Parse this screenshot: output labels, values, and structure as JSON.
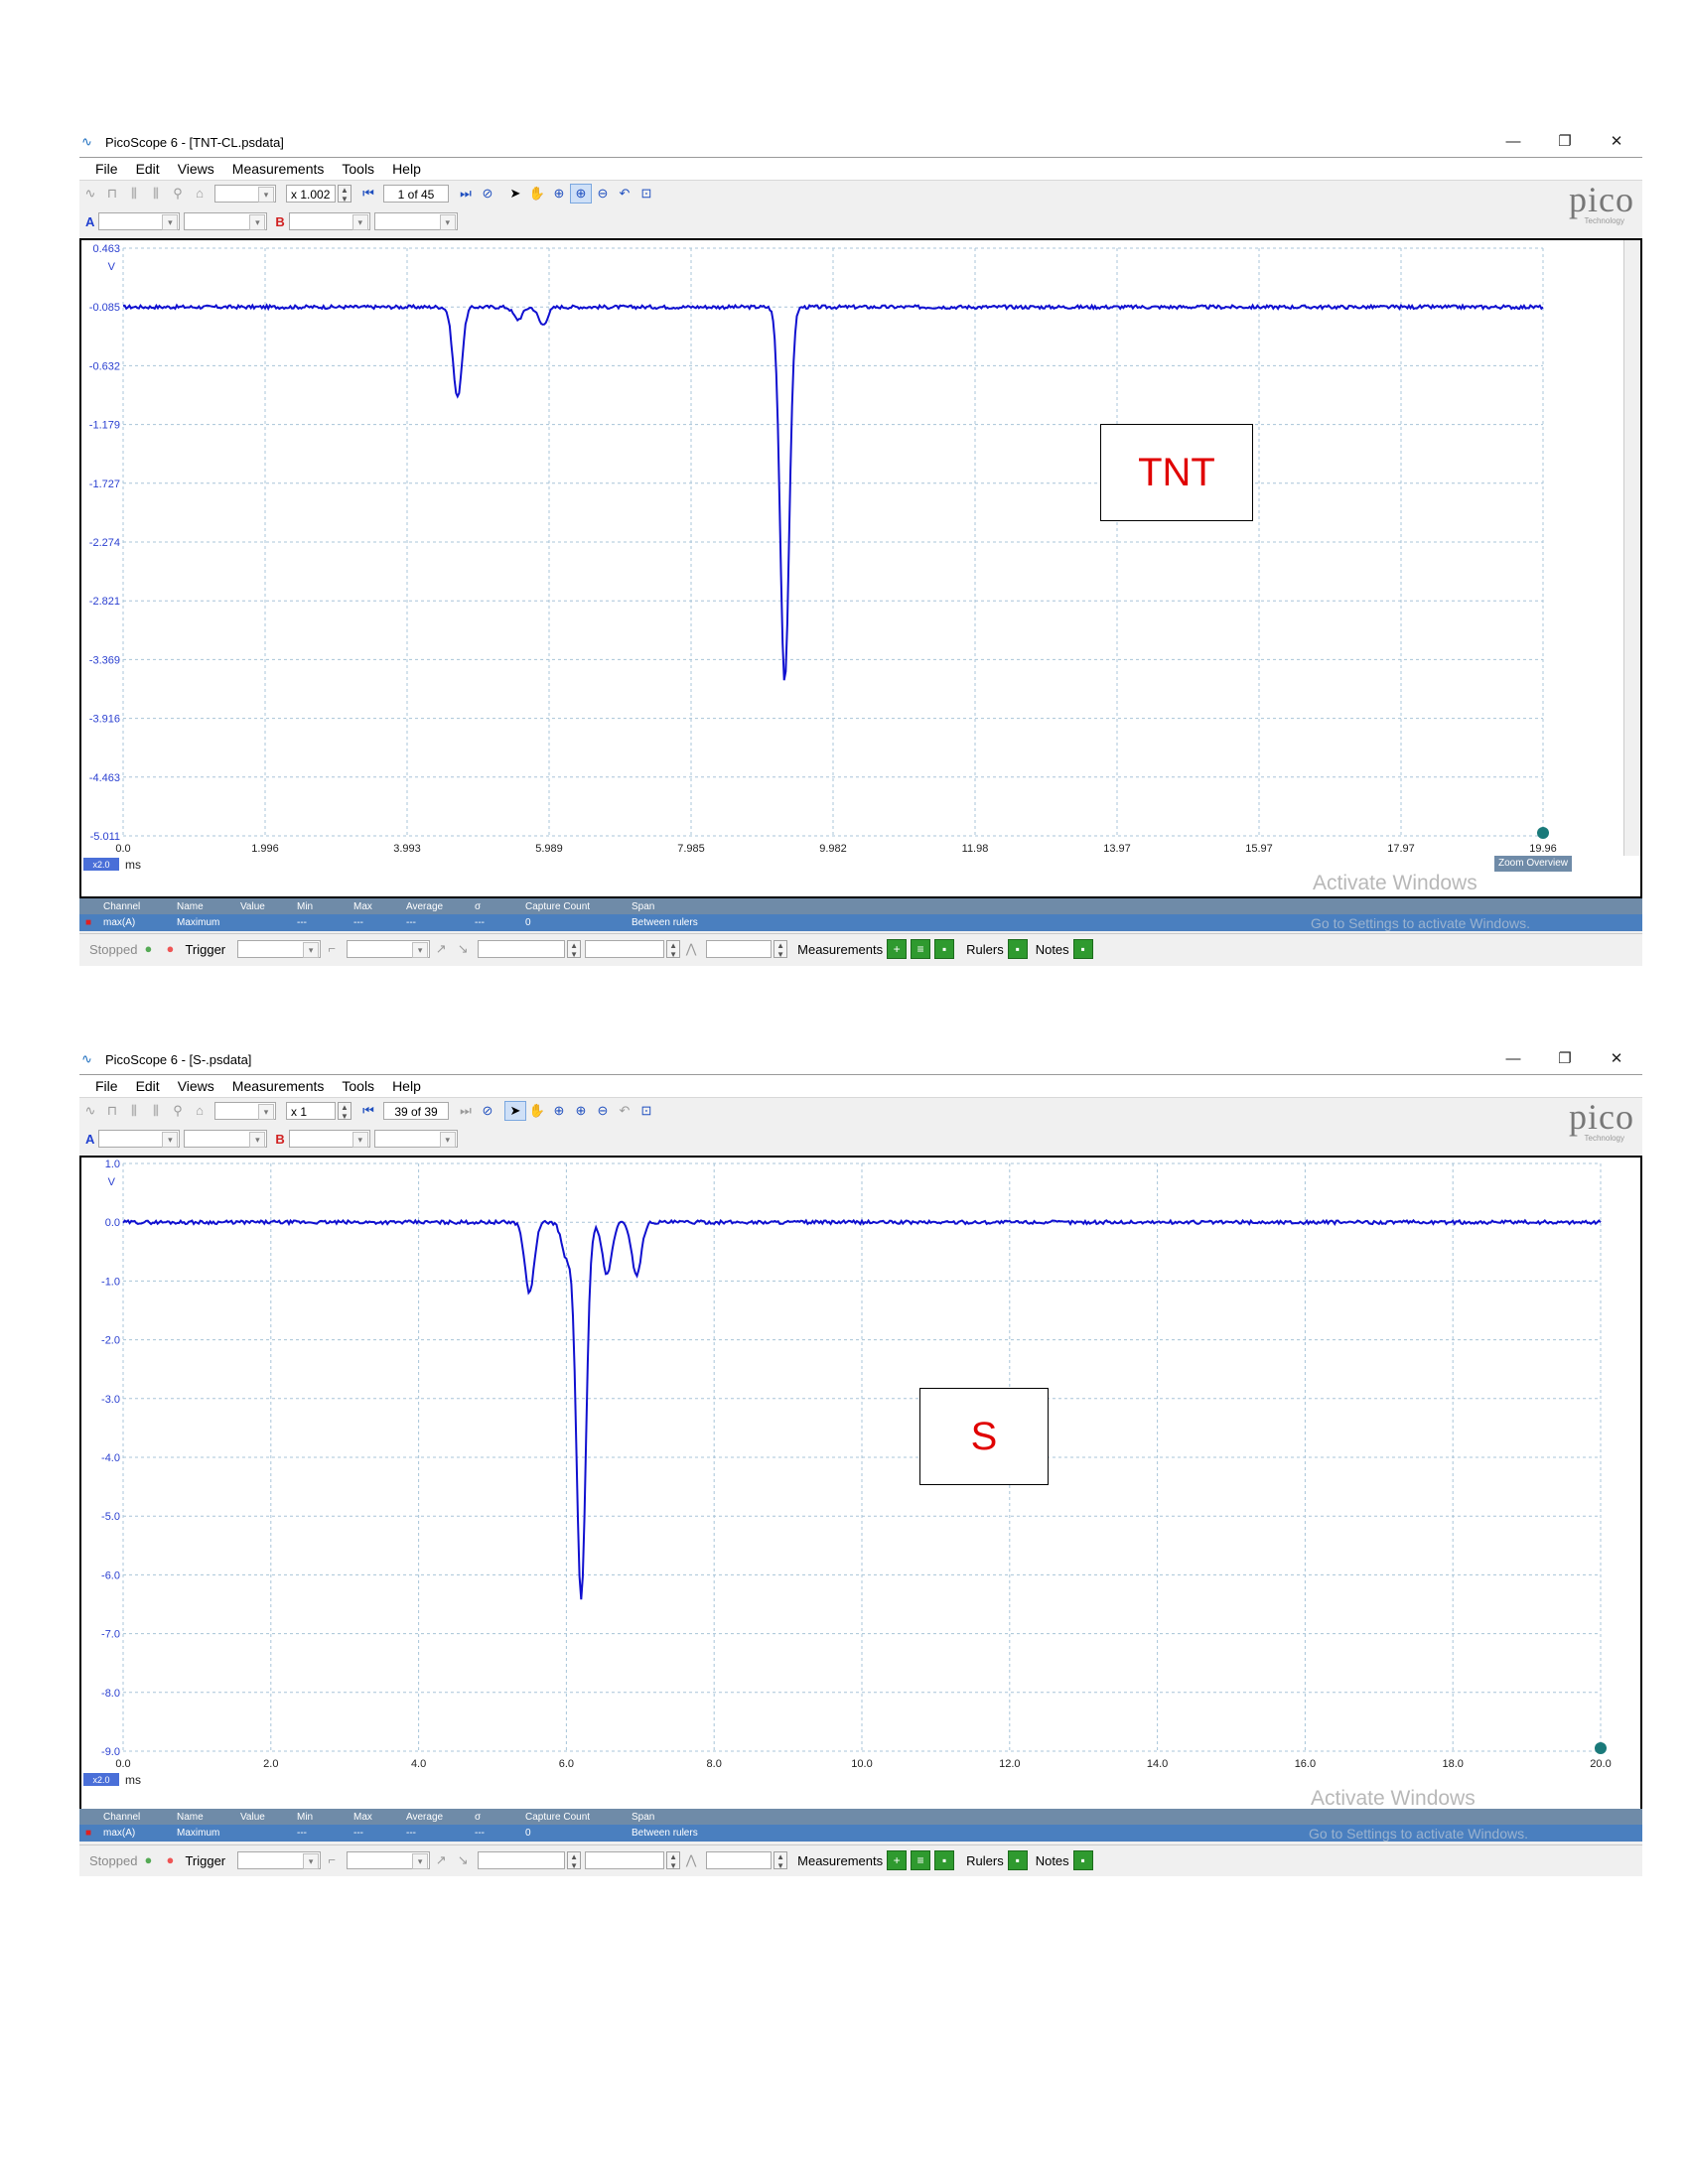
{
  "windows": [
    {
      "title": "PicoScope 6 - [TNT-CL.psdata]",
      "menu": [
        "File",
        "Edit",
        "Views",
        "Measurements",
        "Tools",
        "Help"
      ],
      "zoom_field": "x 1.002",
      "capture_counter": "1 of 45",
      "channel_a": "A",
      "channel_b": "B",
      "y_unit": "V",
      "x_unit": "ms",
      "zoom_badge": "x2.0",
      "y_ticks": [
        "0.463",
        "-0.085",
        "-0.632",
        "-1.179",
        "-1.727",
        "-2.274",
        "-2.821",
        "-3.369",
        "-3.916",
        "-4.463",
        "-5.011"
      ],
      "x_ticks": [
        "0.0",
        "1.996",
        "3.993",
        "5.989",
        "7.985",
        "9.982",
        "11.98",
        "13.97",
        "15.97",
        "17.97",
        "19.96"
      ],
      "annotation": "TNT",
      "zoom_overview": "Zoom Overview",
      "measurements": {
        "headers": [
          "Channel",
          "Name",
          "Value",
          "Min",
          "Max",
          "Average",
          "σ",
          "Capture Count",
          "Span"
        ],
        "row": [
          "max(A)",
          "Maximum",
          "",
          "---",
          "---",
          "---",
          "---",
          "0",
          "Between rulers"
        ]
      },
      "watermark": [
        "Activate Windows",
        "Go to Settings to activate Windows."
      ],
      "status": {
        "state": "Stopped",
        "trigger": "Trigger",
        "measurements": "Measurements",
        "rulers": "Rulers",
        "notes": "Notes"
      }
    },
    {
      "title": "PicoScope 6 - [S-.psdata]",
      "menu": [
        "File",
        "Edit",
        "Views",
        "Measurements",
        "Tools",
        "Help"
      ],
      "zoom_field": "x 1",
      "capture_counter": "39 of 39",
      "channel_a": "A",
      "channel_b": "B",
      "y_unit": "V",
      "x_unit": "ms",
      "zoom_badge": "x2.0",
      "y_ticks": [
        "1.0",
        "0.0",
        "-1.0",
        "-2.0",
        "-3.0",
        "-4.0",
        "-5.0",
        "-6.0",
        "-7.0",
        "-8.0",
        "-9.0"
      ],
      "x_ticks": [
        "0.0",
        "2.0",
        "4.0",
        "6.0",
        "8.0",
        "10.0",
        "12.0",
        "14.0",
        "16.0",
        "18.0",
        "20.0"
      ],
      "annotation": "S",
      "measurements": {
        "headers": [
          "Channel",
          "Name",
          "Value",
          "Min",
          "Max",
          "Average",
          "σ",
          "Capture Count",
          "Span"
        ],
        "row": [
          "max(A)",
          "Maximum",
          "",
          "---",
          "---",
          "---",
          "---",
          "0",
          "Between rulers"
        ]
      },
      "watermark": [
        "Activate Windows",
        "Go to Settings to activate Windows."
      ],
      "status": {
        "state": "Stopped",
        "trigger": "Trigger",
        "measurements": "Measurements",
        "rulers": "Rulers",
        "notes": "Notes"
      }
    }
  ],
  "logo": {
    "text": "pico",
    "sub": "Technology"
  },
  "colors": {
    "trace": "#1010d0",
    "grid": "#a8c4d8",
    "axis_text": "#2a3fd0",
    "annotation": "#e00000"
  },
  "chart_data": [
    {
      "type": "line",
      "xlabel": "ms",
      "ylabel": "V",
      "xlim": [
        0,
        19.96
      ],
      "ylim": [
        -5.011,
        0.463
      ],
      "baseline": -0.085,
      "peaks": [
        {
          "x": 4.7,
          "y": -0.93
        },
        {
          "x": 5.55,
          "y": -0.2
        },
        {
          "x": 5.9,
          "y": -0.25
        },
        {
          "x": 9.3,
          "y": -3.57
        }
      ]
    },
    {
      "type": "line",
      "xlabel": "ms",
      "ylabel": "V",
      "xlim": [
        0,
        20.0
      ],
      "ylim": [
        -9.0,
        1.0
      ],
      "baseline": 0.0,
      "peaks": [
        {
          "x": 5.5,
          "y": -1.2
        },
        {
          "x": 6.0,
          "y": -0.6
        },
        {
          "x": 6.2,
          "y": -6.4
        },
        {
          "x": 6.55,
          "y": -0.9
        },
        {
          "x": 6.95,
          "y": -0.9
        }
      ]
    }
  ]
}
